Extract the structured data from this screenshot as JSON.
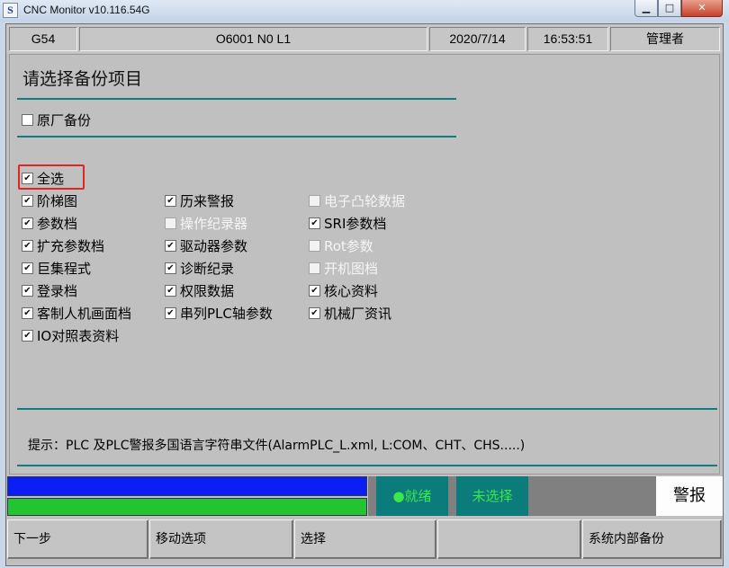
{
  "window": {
    "title": "CNC Monitor v10.116.54G",
    "icon_letter": "S",
    "controls": {
      "minimize": "▁",
      "maximize": "□",
      "close": "✕"
    }
  },
  "status": {
    "coord": "G54",
    "program": "O6001 N0 L1",
    "date": "2020/7/14",
    "time": "16:53:51",
    "user": "管理者"
  },
  "heading": "请选择备份项目",
  "factory_backup": {
    "label": "原厂备份",
    "checked": false
  },
  "select_all": {
    "label": "全选",
    "checked": true
  },
  "items": {
    "col1": [
      {
        "label": "阶梯图",
        "checked": true,
        "enabled": true
      },
      {
        "label": "参数档",
        "checked": true,
        "enabled": true
      },
      {
        "label": "扩充参数档",
        "checked": true,
        "enabled": true
      },
      {
        "label": "巨集程式",
        "checked": true,
        "enabled": true
      },
      {
        "label": "登录档",
        "checked": true,
        "enabled": true
      },
      {
        "label": "客制人机画面档",
        "checked": true,
        "enabled": true
      },
      {
        "label": "IO对照表资料",
        "checked": true,
        "enabled": true
      }
    ],
    "col2": [
      {
        "label": "历来警报",
        "checked": true,
        "enabled": true
      },
      {
        "label": "操作纪录器",
        "checked": false,
        "enabled": false
      },
      {
        "label": "驱动器参数",
        "checked": true,
        "enabled": true
      },
      {
        "label": "诊断纪录",
        "checked": true,
        "enabled": true
      },
      {
        "label": "权限数据",
        "checked": true,
        "enabled": true
      },
      {
        "label": "串列PLC轴参数",
        "checked": true,
        "enabled": true
      }
    ],
    "col3": [
      {
        "label": "电子凸轮数据",
        "checked": false,
        "enabled": false
      },
      {
        "label": "SRI参数档",
        "checked": true,
        "enabled": true
      },
      {
        "label": "Rot参数",
        "checked": false,
        "enabled": false
      },
      {
        "label": "开机图档",
        "checked": false,
        "enabled": false
      },
      {
        "label": "核心资料",
        "checked": true,
        "enabled": true
      },
      {
        "label": "机械厂资讯",
        "checked": true,
        "enabled": true
      }
    ]
  },
  "hint": "提示：PLC 及PLC警报多国语言字符串文件(AlarmPLC_L.xml, L:COM、CHT、CHS.....)",
  "indicators": {
    "ready": "●就绪",
    "not_selected": "未选择",
    "alarm": "警报"
  },
  "function_keys": [
    "下一步",
    "移动选项",
    "选择",
    "",
    "系统内部备份"
  ],
  "colors": {
    "teal": "#117e7e",
    "indicator_text": "#3be84a",
    "bar_blue": "#0a1ef5",
    "bar_green": "#22c531",
    "highlight": "#e32424"
  }
}
